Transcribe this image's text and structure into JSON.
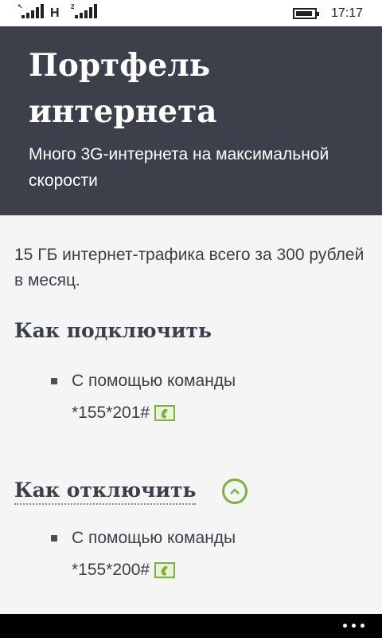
{
  "status": {
    "sim1_tag": "↖",
    "network_type": "H",
    "sim2_tag": "2",
    "time": "17:17"
  },
  "header": {
    "title": "Портфель интернета",
    "subtitle": "Много 3G-интернета на максимальной скорости"
  },
  "content": {
    "intro": "15 ГБ интернет-трафика  всего за 300 рублей в месяц.",
    "connect": {
      "title": "Как подключить",
      "method_label": "С помощью команды",
      "code": "*155*201#"
    },
    "disconnect": {
      "title": "Как отключить",
      "method_label": "С помощью команды",
      "code": "*155*200#"
    }
  },
  "colors": {
    "header_bg": "#3b404b",
    "accent": "#7ab33a",
    "page_bg": "#f4f5f4"
  },
  "icons": [
    "signal-icon",
    "battery-icon",
    "phone-call-icon",
    "chevron-up-icon",
    "more-dots-icon"
  ]
}
